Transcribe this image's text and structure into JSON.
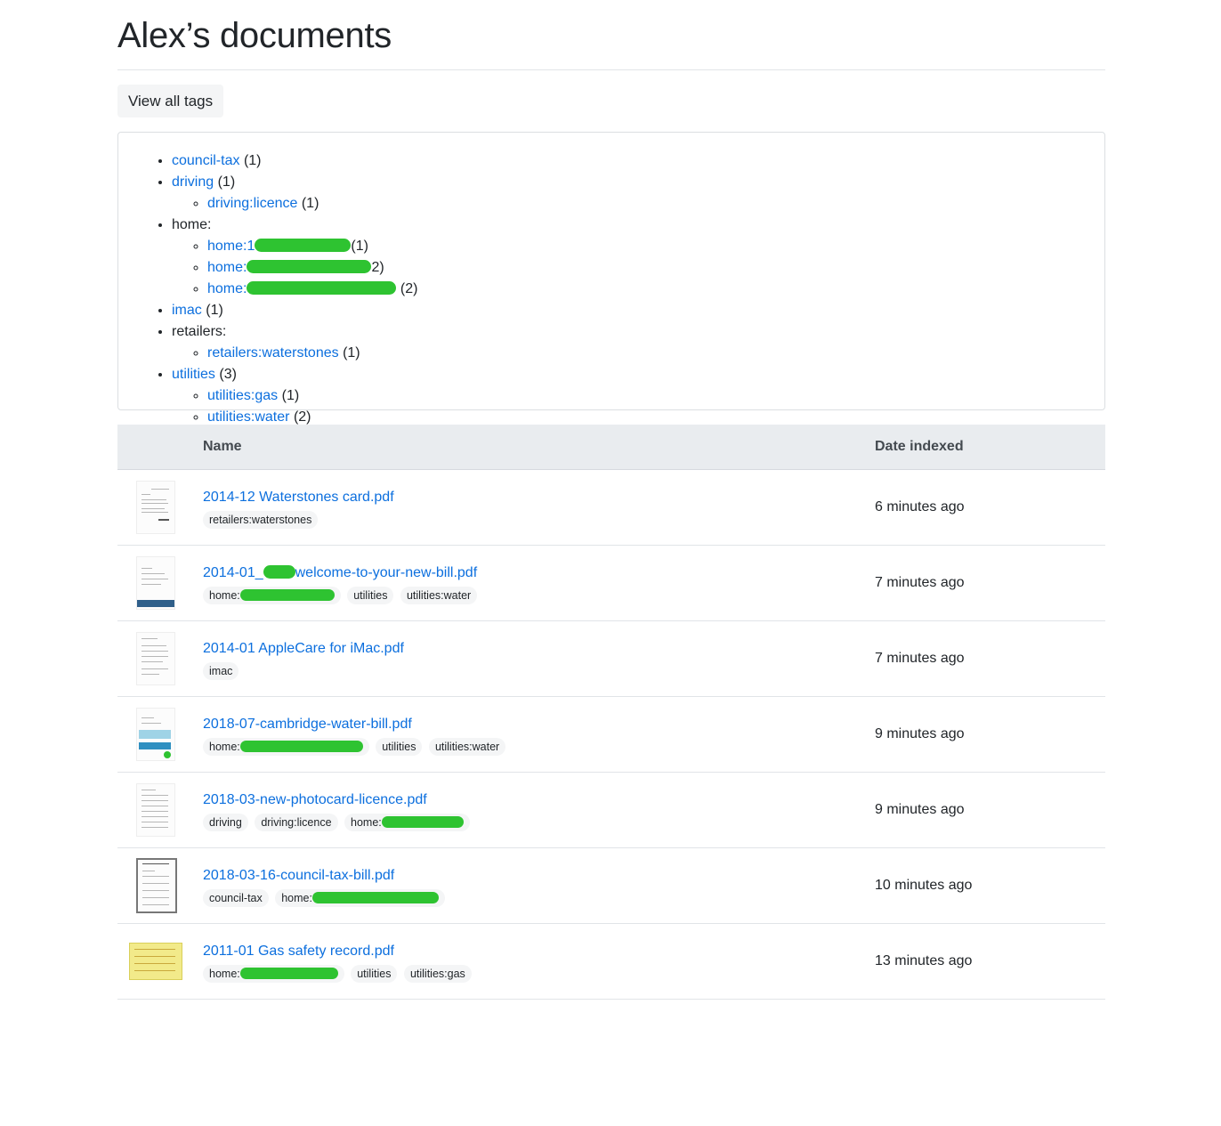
{
  "page": {
    "title": "Alex’s documents"
  },
  "toolbar": {
    "view_all_tags_label": "View all tags"
  },
  "tag_tree": {
    "council_tax": {
      "label": "council-tax",
      "count": "(1)"
    },
    "driving": {
      "label": "driving",
      "count": "(1)"
    },
    "driving_licence": {
      "label": "driving:licence",
      "count": "(1)"
    },
    "home": {
      "label": "home:"
    },
    "home_1": {
      "label": "home:1",
      "count": "(1)"
    },
    "home_2": {
      "label": "home:",
      "count": "2)"
    },
    "home_3": {
      "label": "home:",
      "count": "(2)"
    },
    "imac": {
      "label": "imac",
      "count": "(1)"
    },
    "retailers": {
      "label": "retailers:"
    },
    "retailers_waterstones": {
      "label": "retailers:waterstones",
      "count": "(1)"
    },
    "utilities": {
      "label": "utilities",
      "count": "(3)"
    },
    "utilities_gas": {
      "label": "utilities:gas",
      "count": "(1)"
    },
    "utilities_water": {
      "label": "utilities:water",
      "count": "(2)"
    }
  },
  "table": {
    "headers": {
      "name": "Name",
      "date": "Date indexed"
    },
    "rows": [
      {
        "name": "2014-12 Waterstones card.pdf",
        "tags": [
          "retailers:waterstones"
        ],
        "date": "6 minutes ago"
      },
      {
        "name_a": "2014-01_",
        "name_b": "welcome-to-your-new-bill.pdf",
        "tags": [
          "home:",
          "utilities",
          "utilities:water"
        ],
        "date": "7 minutes ago"
      },
      {
        "name": "2014-01 AppleCare for iMac.pdf",
        "tags": [
          "imac"
        ],
        "date": "7 minutes ago"
      },
      {
        "name": "2018-07-cambridge-water-bill.pdf",
        "tags": [
          "home:",
          "utilities",
          "utilities:water"
        ],
        "date": "9 minutes ago"
      },
      {
        "name": "2018-03-new-photocard-licence.pdf",
        "tags": [
          "driving",
          "driving:licence",
          "home:"
        ],
        "date": "9 minutes ago"
      },
      {
        "name": "2018-03-16-council-tax-bill.pdf",
        "tags": [
          "council-tax",
          "home:"
        ],
        "date": "10 minutes ago"
      },
      {
        "name": "2011-01 Gas safety record.pdf",
        "tags": [
          "home:",
          "utilities",
          "utilities:gas"
        ],
        "date": "13 minutes ago"
      }
    ]
  }
}
